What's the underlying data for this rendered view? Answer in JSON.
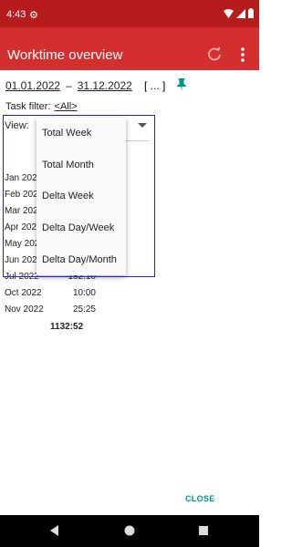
{
  "status_bar": {
    "time": "4:43"
  },
  "app_bar": {
    "title": "Worktime overview"
  },
  "filters": {
    "date_from": "01.01.2022",
    "date_separator": "–",
    "date_to": "31.12.2022",
    "more_button": "[ ... ]",
    "task_filter_label": "Task filter:",
    "task_filter_value": "<All>",
    "view_label": "View:"
  },
  "view_options": [
    "Total Week",
    "Total Month",
    "Delta Week",
    "Delta Day/Week",
    "Delta Day/Month"
  ],
  "worktime": {
    "rows": [
      {
        "month": "Jan 2022",
        "value": ""
      },
      {
        "month": "Feb 2022",
        "value": ""
      },
      {
        "month": "Mar 2022",
        "value": ""
      },
      {
        "month": "Apr 2022",
        "value": ""
      },
      {
        "month": "May 2022",
        "value": ""
      },
      {
        "month": "Jun 2022",
        "value": ""
      },
      {
        "month": "Jul 2022",
        "value": "182:10"
      },
      {
        "month": "Oct 2022",
        "value": "10:00"
      },
      {
        "month": "Nov 2022",
        "value": "25:25"
      }
    ],
    "total": "1132:52"
  },
  "dialog": {
    "close_label": "CLOSE"
  },
  "colors": {
    "status_bar": "#b71c1c",
    "app_bar": "#d32f2f",
    "accent": "#009688",
    "highlight": "#2020e0"
  }
}
